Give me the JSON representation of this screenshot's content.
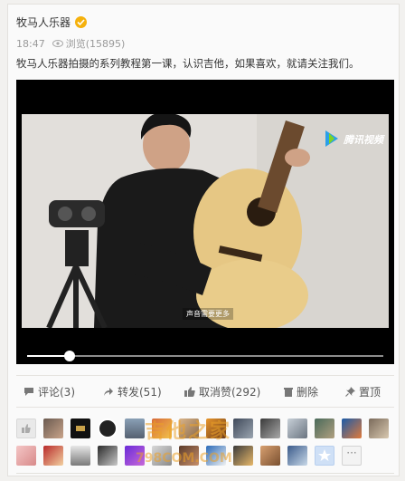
{
  "post": {
    "author": "牧马人乐器",
    "time": "18:47",
    "views": "浏览(15895)",
    "text": "牧马人乐器拍摄的系列教程第一课，认识吉他，如果喜欢，就请关注我们。"
  },
  "video": {
    "logo_text": "腾讯视频",
    "caption": "声音需要更多",
    "progress": 0.12
  },
  "actions": {
    "comment": "评论(3)",
    "repost": "转发(51)",
    "unlike": "取消赞(292)",
    "delete": "删除",
    "pin": "置顶"
  },
  "watermark": {
    "main": "吉他之家",
    "sub": "798COM.COM"
  },
  "colors": {
    "badge": "#f5b10c",
    "video_bg": "#000000",
    "progress": "#ffffff"
  },
  "likers": {
    "more_label": "···"
  }
}
